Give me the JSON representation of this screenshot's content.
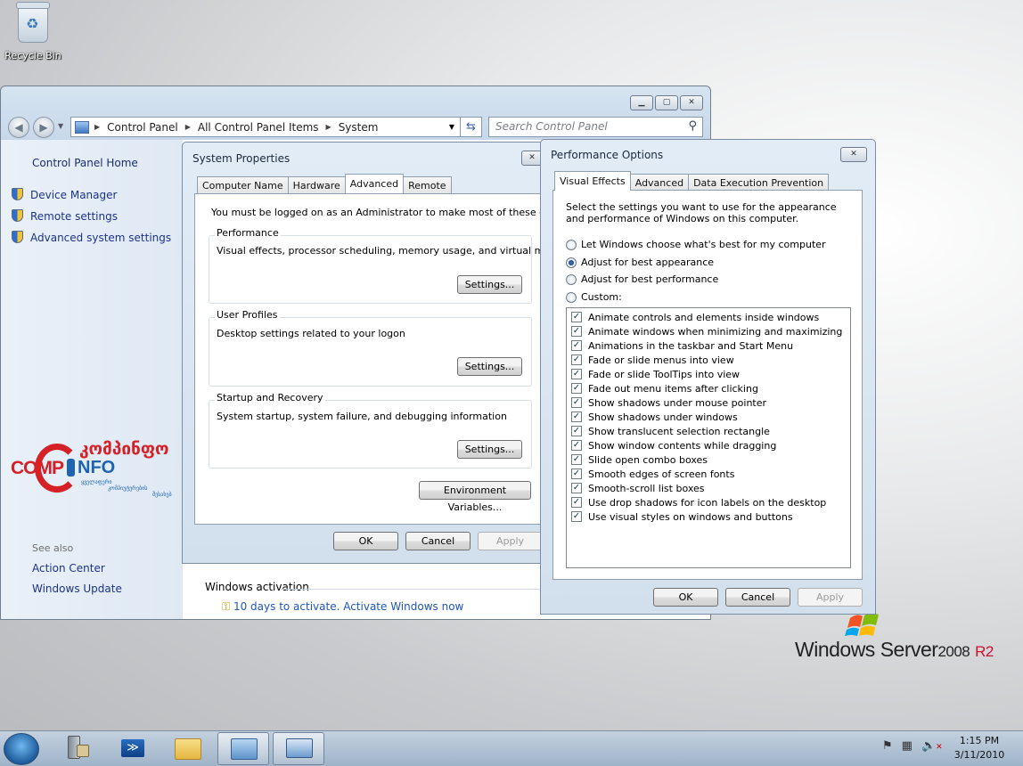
{
  "desktop": {
    "recycle_bin": "Recycle Bin",
    "brand_windows": "Windows Server",
    "brand_version": "2008",
    "brand_r2": "R2"
  },
  "cp": {
    "breadcrumb": [
      "Control Panel",
      "All Control Panel Items",
      "System"
    ],
    "search_placeholder": "Search Control Panel",
    "sidebar": {
      "home": "Control Panel Home",
      "items": [
        "Device Manager",
        "Remote settings",
        "Advanced system settings"
      ],
      "see_also": "See also",
      "see_also_items": [
        "Action Center",
        "Windows Update"
      ]
    },
    "activation_header": "Windows activation",
    "activation_link": "10 days to activate. Activate Windows now",
    "logo_main": "COMP",
    "logo_main2": "NFO",
    "logo_geo": "კომპინფო",
    "logo_sub1": "ყველაფერი",
    "logo_sub2": "კომპიუტერების",
    "logo_sub3": "შესახებ"
  },
  "sysprops": {
    "title": "System Properties",
    "tabs": [
      "Computer Name",
      "Hardware",
      "Advanced",
      "Remote"
    ],
    "admin_note": "You must be logged on as an Administrator to make most of these changes.",
    "groups": [
      {
        "title": "Performance",
        "desc": "Visual effects, processor scheduling, memory usage, and virtual memory",
        "button": "Settings..."
      },
      {
        "title": "User Profiles",
        "desc": "Desktop settings related to your logon",
        "button": "Settings..."
      },
      {
        "title": "Startup and Recovery",
        "desc": "System startup, system failure, and debugging information",
        "button": "Settings..."
      }
    ],
    "env_button": "Environment Variables...",
    "ok": "OK",
    "cancel": "Cancel",
    "apply": "Apply"
  },
  "perf": {
    "title": "Performance Options",
    "tabs": [
      "Visual Effects",
      "Advanced",
      "Data Execution Prevention"
    ],
    "intro": "Select the settings you want to use for the appearance and performance of Windows on this computer.",
    "radios": [
      {
        "label": "Let Windows choose what's best for my computer",
        "selected": false
      },
      {
        "label": "Adjust for best appearance",
        "selected": true
      },
      {
        "label": "Adjust for best performance",
        "selected": false
      },
      {
        "label": "Custom:",
        "selected": false
      }
    ],
    "effects": [
      "Animate controls and elements inside windows",
      "Animate windows when minimizing and maximizing",
      "Animations in the taskbar and Start Menu",
      "Fade or slide menus into view",
      "Fade or slide ToolTips into view",
      "Fade out menu items after clicking",
      "Show shadows under mouse pointer",
      "Show shadows under windows",
      "Show translucent selection rectangle",
      "Show window contents while dragging",
      "Slide open combo boxes",
      "Smooth edges of screen fonts",
      "Smooth-scroll list boxes",
      "Use drop shadows for icon labels on the desktop",
      "Use visual styles on windows and buttons"
    ],
    "ok": "OK",
    "cancel": "Cancel",
    "apply": "Apply"
  },
  "taskbar": {
    "time": "1:15 PM",
    "date": "3/11/2010"
  }
}
